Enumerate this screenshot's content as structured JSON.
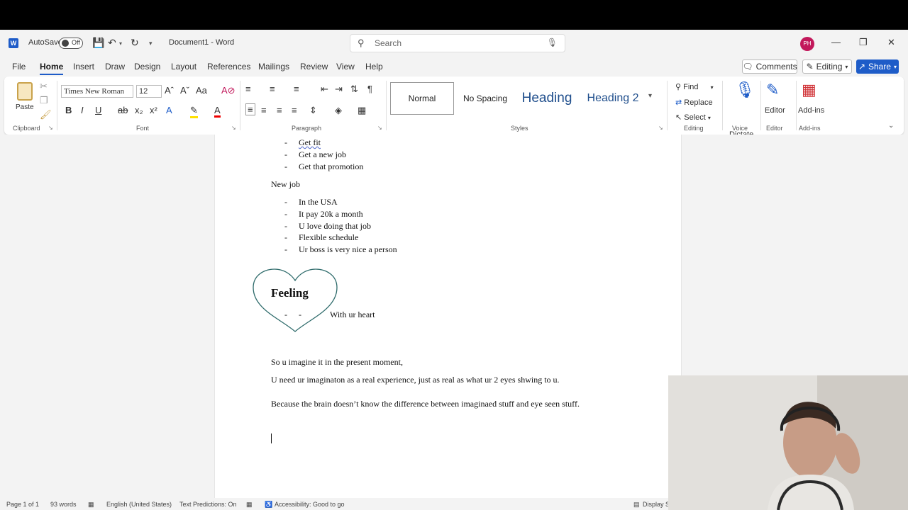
{
  "titlebar": {
    "autosave_label": "AutoSave",
    "autosave_state": "Off",
    "doc_title": "Document1 - Word",
    "search_placeholder": "Search",
    "user_initials": "PH"
  },
  "tabs": [
    "File",
    "Home",
    "Insert",
    "Draw",
    "Design",
    "Layout",
    "References",
    "Mailings",
    "Review",
    "View",
    "Help"
  ],
  "active_tab": "Home",
  "actions": {
    "comments": "Comments",
    "editing": "Editing",
    "share": "Share"
  },
  "ribbon": {
    "clipboard": {
      "label": "Clipboard",
      "paste": "Paste"
    },
    "font": {
      "label": "Font",
      "family": "Times New Roman",
      "size": "12"
    },
    "paragraph": {
      "label": "Paragraph"
    },
    "styles": {
      "label": "Styles",
      "items": [
        "Normal",
        "No Spacing",
        "Heading",
        "Heading 2"
      ]
    },
    "editing": {
      "label": "Editing",
      "find": "Find",
      "replace": "Replace",
      "select": "Select"
    },
    "voice": {
      "label": "Voice",
      "dictate": "Dictate"
    },
    "editor": {
      "label": "Editor",
      "editor": "Editor"
    },
    "addins": {
      "label": "Add-ins",
      "addins": "Add-ins"
    }
  },
  "document": {
    "list1": [
      "Get fit",
      "Get a new job",
      "Get that promotion"
    ],
    "heading_newjob": "New job",
    "list2": [
      "In the USA",
      "It pay 20k a month",
      "U love doing that job",
      "Flexible schedule",
      "Ur boss is very nice a person"
    ],
    "heart_title": "Feeling",
    "heart_line": "With ur heart",
    "para1": "So u imagine it in the present moment,",
    "para2": "U need ur imaginaton as a real experience, just as real as what ur 2 eyes shwing to u.",
    "para3": "Because the brain doesn’t know the difference between imaginaed stuff and eye seen stuff."
  },
  "status": {
    "page": "Page 1 of 1",
    "words": "93 words",
    "language": "English (United States)",
    "predictions": "Text Predictions: On",
    "accessibility": "Accessibility: Good to go",
    "display": "Display S"
  }
}
